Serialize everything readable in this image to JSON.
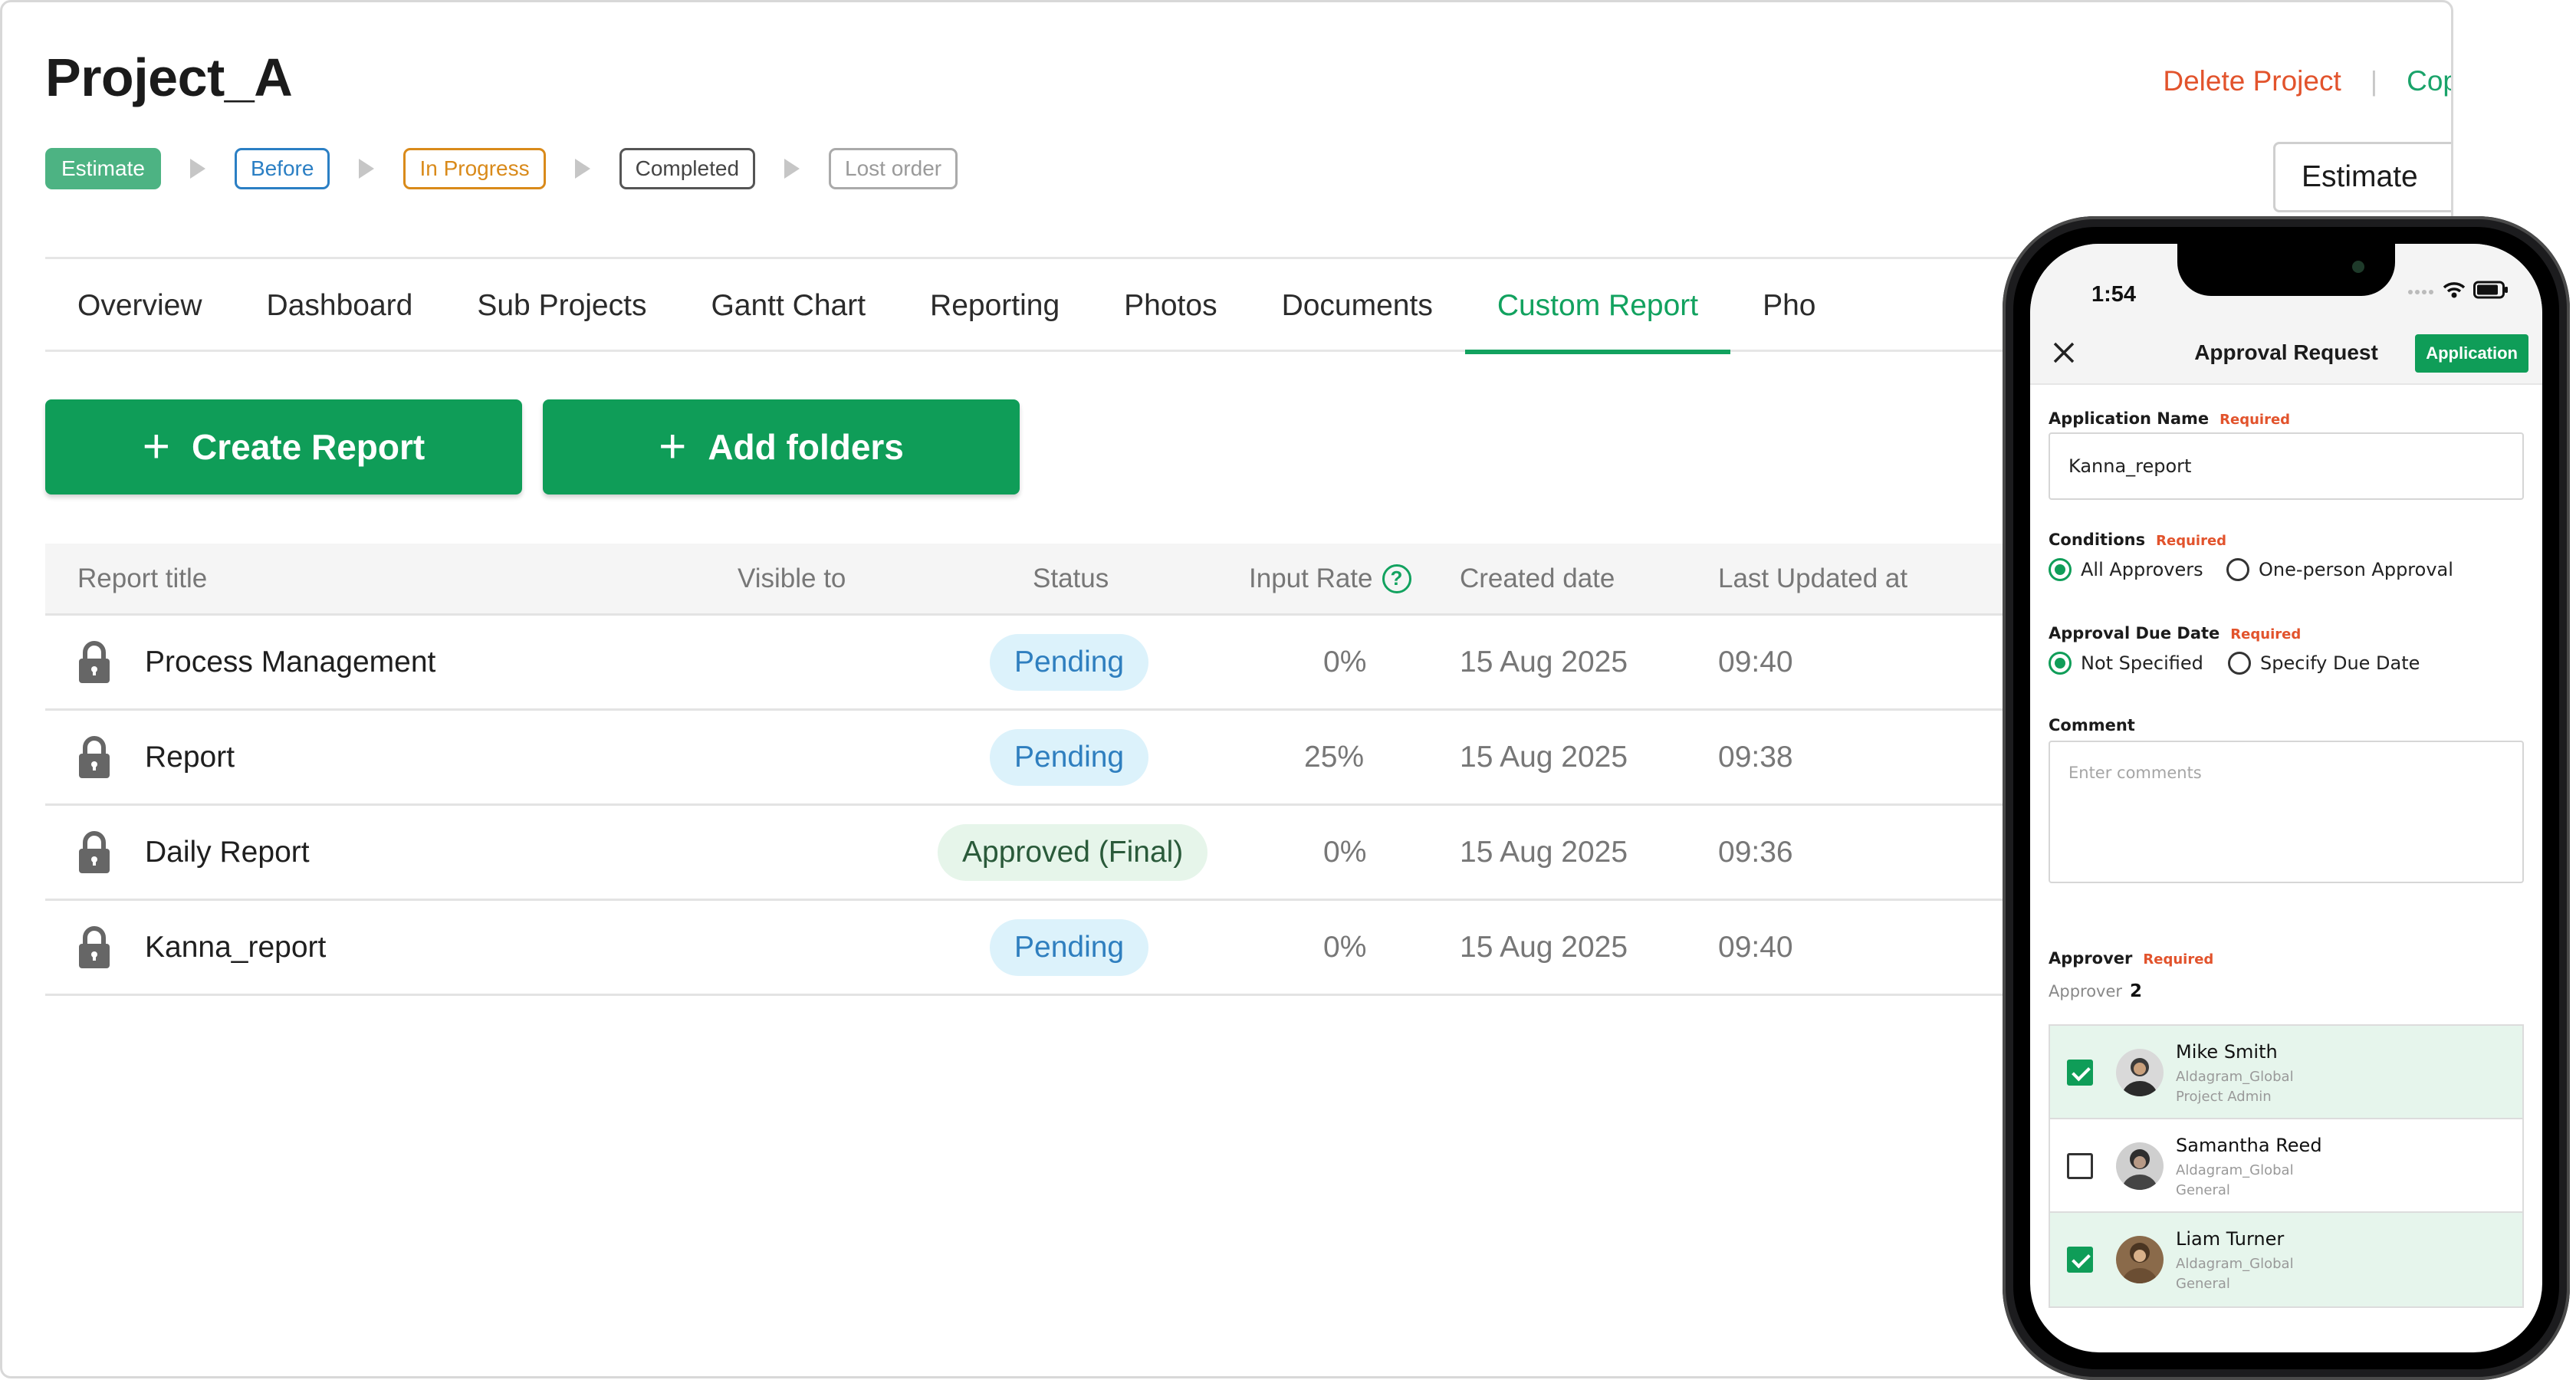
{
  "project": {
    "title": "Project_A",
    "delete_label": "Delete Project",
    "separator": "|",
    "copy_label": "Cop",
    "estimate_button": "Estimate"
  },
  "stages": [
    "Estimate",
    "Before",
    "In Progress",
    "Completed",
    "Lost order"
  ],
  "tabs": [
    "Overview",
    "Dashboard",
    "Sub Projects",
    "Gantt Chart",
    "Reporting",
    "Photos",
    "Documents",
    "Custom Report",
    "Pho"
  ],
  "active_tab": "Custom Report",
  "actions": {
    "create_report": "Create Report",
    "add_folders": "Add folders",
    "plus": "+"
  },
  "table": {
    "headers": {
      "title": "Report title",
      "visible_to": "Visible to",
      "status": "Status",
      "input_rate": "Input Rate",
      "created": "Created date",
      "updated": "Last Updated at",
      "help": "?"
    },
    "rows": [
      {
        "title": "Process Management",
        "status": "Pending",
        "rate": "0%",
        "created": "15 Aug 2025",
        "updated": "09:40"
      },
      {
        "title": "Report",
        "status": "Pending",
        "rate": "25%",
        "created": "15 Aug 2025",
        "updated": "09:38"
      },
      {
        "title": "Daily Report",
        "status": "Approved (Final)",
        "rate": "0%",
        "created": "15 Aug 2025",
        "updated": "09:36"
      },
      {
        "title": "Kanna_report",
        "status": "Pending",
        "rate": "0%",
        "created": "15 Aug 2025",
        "updated": "09:40"
      }
    ]
  },
  "phone": {
    "time": "1:54",
    "nav_title": "Approval Request",
    "apply_button": "Application",
    "required_label": "Required",
    "application_name_label": "Application Name",
    "application_name_value": "Kanna_report",
    "conditions_label": "Conditions",
    "conditions_options": [
      "All Approvers",
      "One-person Approval"
    ],
    "due_date_label": "Approval Due Date",
    "due_date_options": [
      "Not Specified",
      "Specify Due Date"
    ],
    "comment_label": "Comment",
    "comment_placeholder": "Enter comments",
    "approver_label": "Approver",
    "approver_count_label": "Approver",
    "approver_count": "2",
    "approvers": [
      {
        "name": "Mike Smith",
        "org": "Aldagram_Global",
        "role": "Project Admin",
        "checked": true
      },
      {
        "name": "Samantha Reed",
        "org": "Aldagram_Global",
        "role": "General",
        "checked": false
      },
      {
        "name": "Liam Turner",
        "org": "Aldagram_Global",
        "role": "General",
        "checked": true
      }
    ]
  },
  "colors": {
    "brand_green": "#0f9d58",
    "delete_red": "#e2532c",
    "pending_bg": "#dcf2fb",
    "approved_bg": "#e6f5ea"
  }
}
